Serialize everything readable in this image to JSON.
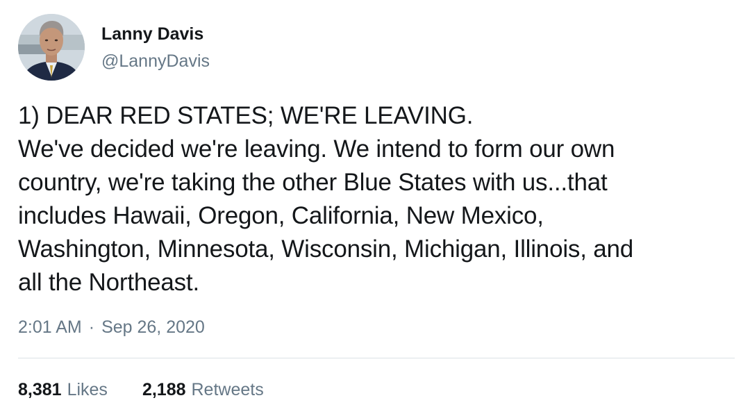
{
  "author": {
    "display_name": "Lanny Davis",
    "handle": "@LannyDavis",
    "avatar_icon": "profile-photo"
  },
  "tweet": {
    "lines": [
      "1) DEAR RED STATES; WE'RE LEAVING.",
      "We've decided we're leaving. We intend to form our own",
      "country, we're taking the other Blue States with us...that",
      "includes Hawaii, Oregon, California, New Mexico,",
      "Washington, Minnesota, Wisconsin, Michigan, Illinois, and",
      "all the Northeast."
    ],
    "time": "2:01 AM",
    "separator": "·",
    "date": "Sep 26, 2020"
  },
  "stats": {
    "likes_count": "8,381",
    "likes_label": "Likes",
    "retweets_count": "2,188",
    "retweets_label": "Retweets"
  },
  "colors": {
    "text_primary": "#14171a",
    "text_secondary": "#657786",
    "divider": "#dbe1e6"
  }
}
